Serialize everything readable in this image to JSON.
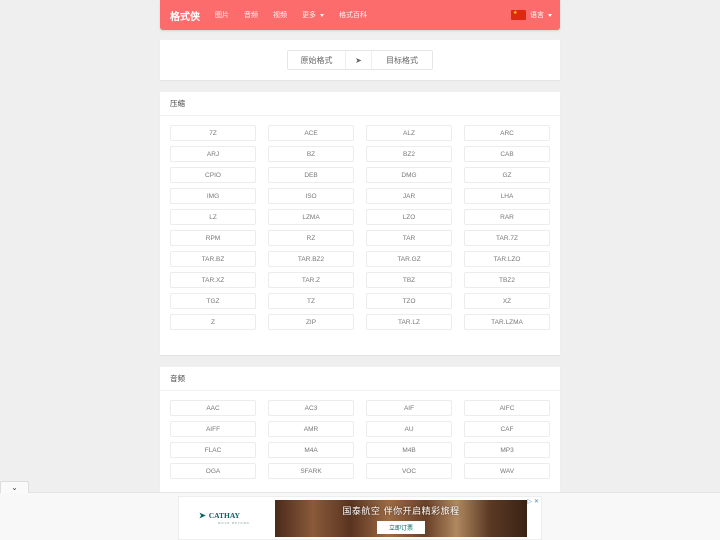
{
  "navbar": {
    "brand": "格式侠",
    "items": [
      {
        "label": "图片",
        "has_caret": false
      },
      {
        "label": "音频",
        "has_caret": false
      },
      {
        "label": "视频",
        "has_caret": false
      },
      {
        "label": "更多",
        "has_caret": true
      },
      {
        "label": "格式百科",
        "has_caret": false
      }
    ],
    "language": {
      "flag": "cn-flag-icon",
      "label": "语言"
    }
  },
  "switcher": {
    "source_label": "原始格式",
    "arrow": "➤",
    "target_label": "目标格式"
  },
  "sections": [
    {
      "title": "压缩",
      "formats": [
        "7Z",
        "ACE",
        "ALZ",
        "ARC",
        "ARJ",
        "BZ",
        "BZ2",
        "CAB",
        "CPIO",
        "DEB",
        "DMG",
        "GZ",
        "IMG",
        "ISO",
        "JAR",
        "LHA",
        "LZ",
        "LZMA",
        "LZO",
        "RAR",
        "RPM",
        "RZ",
        "TAR",
        "TAR.7Z",
        "TAR.BZ",
        "TAR.BZ2",
        "TAR.GZ",
        "TAR.LZO",
        "TAR.XZ",
        "TAR.Z",
        "TBZ",
        "TBZ2",
        "TGZ",
        "TZ",
        "TZO",
        "XZ",
        "Z",
        "ZIP",
        "TAR.LZ",
        "TAR.LZMA"
      ]
    },
    {
      "title": "音频",
      "formats": [
        "AAC",
        "AC3",
        "AIF",
        "AIFC",
        "AIFF",
        "AMR",
        "AU",
        "CAF",
        "FLAC",
        "M4A",
        "M4B",
        "MP3",
        "OGA",
        "SFARK",
        "VOC",
        "WAV"
      ]
    }
  ],
  "collapse_toggle": "⌄",
  "ad": {
    "brand": "CATHAY",
    "brand_sub": "MOVE BEYOND",
    "headline": "国泰航空 伴你开启精彩旅程",
    "cta": "立即订票",
    "close": "✕"
  },
  "colors": {
    "accent": "#fc6c6c",
    "arrow": "#e2535b",
    "cathay": "#006564"
  }
}
